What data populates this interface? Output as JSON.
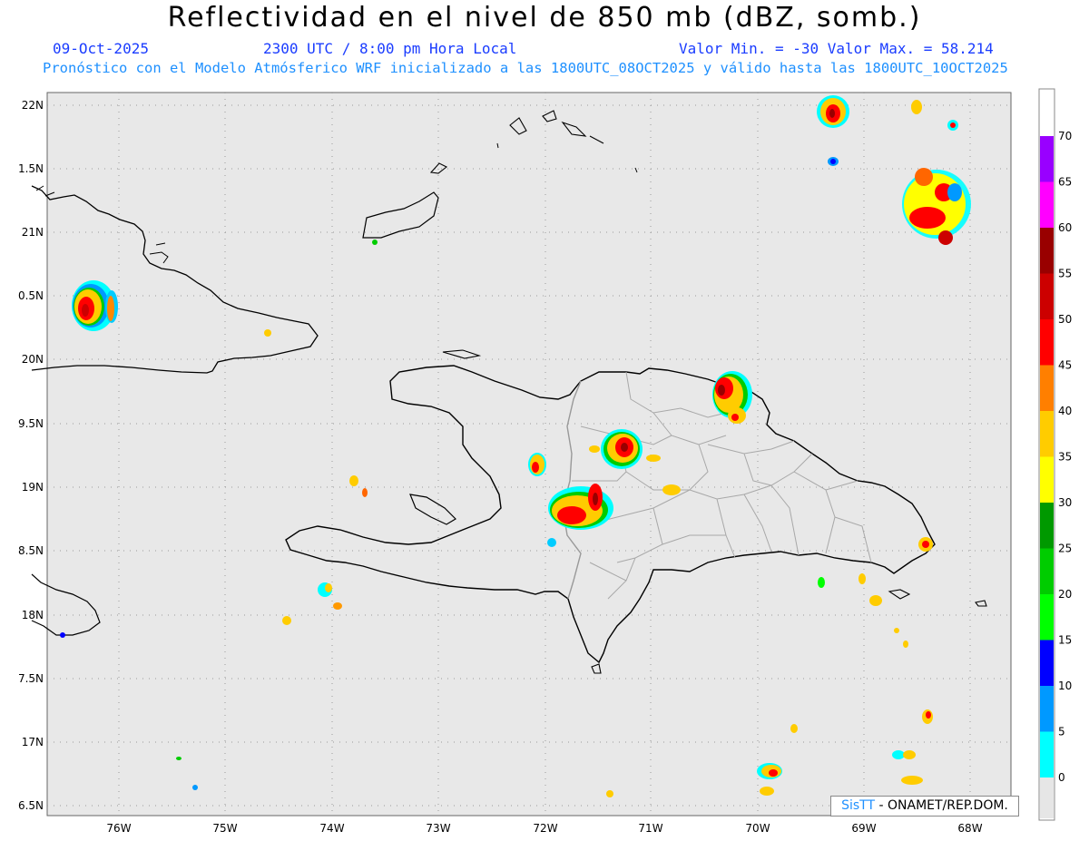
{
  "header": {
    "title": "Reflectividad en el nivel de 850 mb (dBZ, somb.)",
    "date": "09-Oct-2025",
    "time": "2300 UTC / 8:00 pm Hora Local",
    "minmax": "Valor Min. = -30  Valor Max. = 58.214",
    "model_info": "Pronóstico con el Modelo Atmósferico WRF inicializado a las 1800UTC_08OCT2025 y válido hasta las  1800UTC_10OCT2025"
  },
  "map": {
    "lon_labels": [
      "76W",
      "75W",
      "74W",
      "73W",
      "72W",
      "71W",
      "70W",
      "69W",
      "68W"
    ],
    "lat_labels": [
      "22N",
      "1.5N",
      "21N",
      "0.5N",
      "20N",
      "9.5N",
      "19N",
      "8.5N",
      "18N",
      "7.5N",
      "17N",
      "6.5N"
    ],
    "background_color": "#e8e8e8",
    "coast_color": "#000000",
    "province_color": "#a0a0a0"
  },
  "colorbar": {
    "labels": [
      "70",
      "65",
      "60",
      "55",
      "50",
      "45",
      "40",
      "35",
      "30",
      "25",
      "20",
      "15",
      "10",
      "5",
      "0"
    ],
    "colors": [
      "#9900ff",
      "#ff00ff",
      "#990000",
      "#cc0000",
      "#ff0000",
      "#ff7f00",
      "#ffcc00",
      "#ffff00",
      "#009900",
      "#00cc00",
      "#00ff00",
      "#0000ff",
      "#0099ff",
      "#00ffff",
      "#e6e6e6"
    ]
  },
  "credit": {
    "brand": "SisTT",
    "text": " - ONAMET/REP.DOM."
  }
}
